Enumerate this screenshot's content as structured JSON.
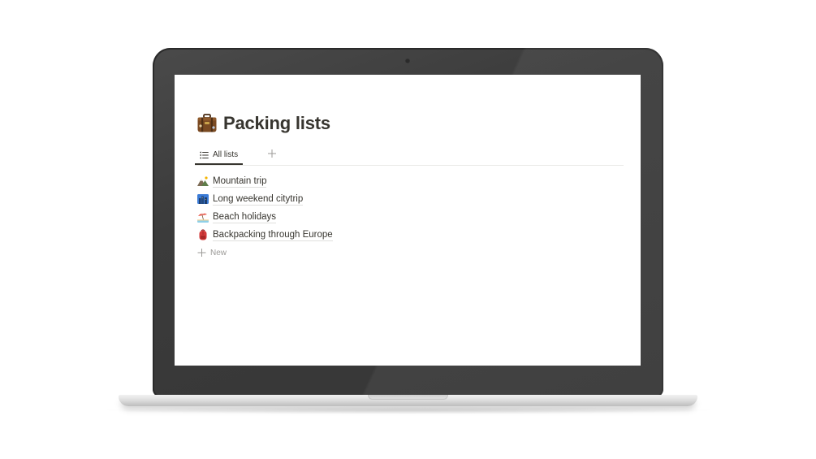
{
  "page": {
    "title": "Packing lists",
    "icon": "suitcase-icon"
  },
  "views": {
    "active_tab": {
      "label": "All lists",
      "icon": "list-icon"
    },
    "add_view_icon": "plus-icon"
  },
  "items": [
    {
      "label": "Mountain trip",
      "icon": "mountain-icon"
    },
    {
      "label": "Long weekend citytrip",
      "icon": "cityscape-icon"
    },
    {
      "label": "Beach holidays",
      "icon": "beach-umbrella-icon"
    },
    {
      "label": "Backpacking through Europe",
      "icon": "backpack-icon"
    }
  ],
  "new_row": {
    "label": "New",
    "icon": "plus-icon"
  },
  "colors": {
    "text": "#37352f",
    "muted": "#9b9a97",
    "bezel": "#3b3b3b",
    "divider": "#e9e9e7"
  }
}
